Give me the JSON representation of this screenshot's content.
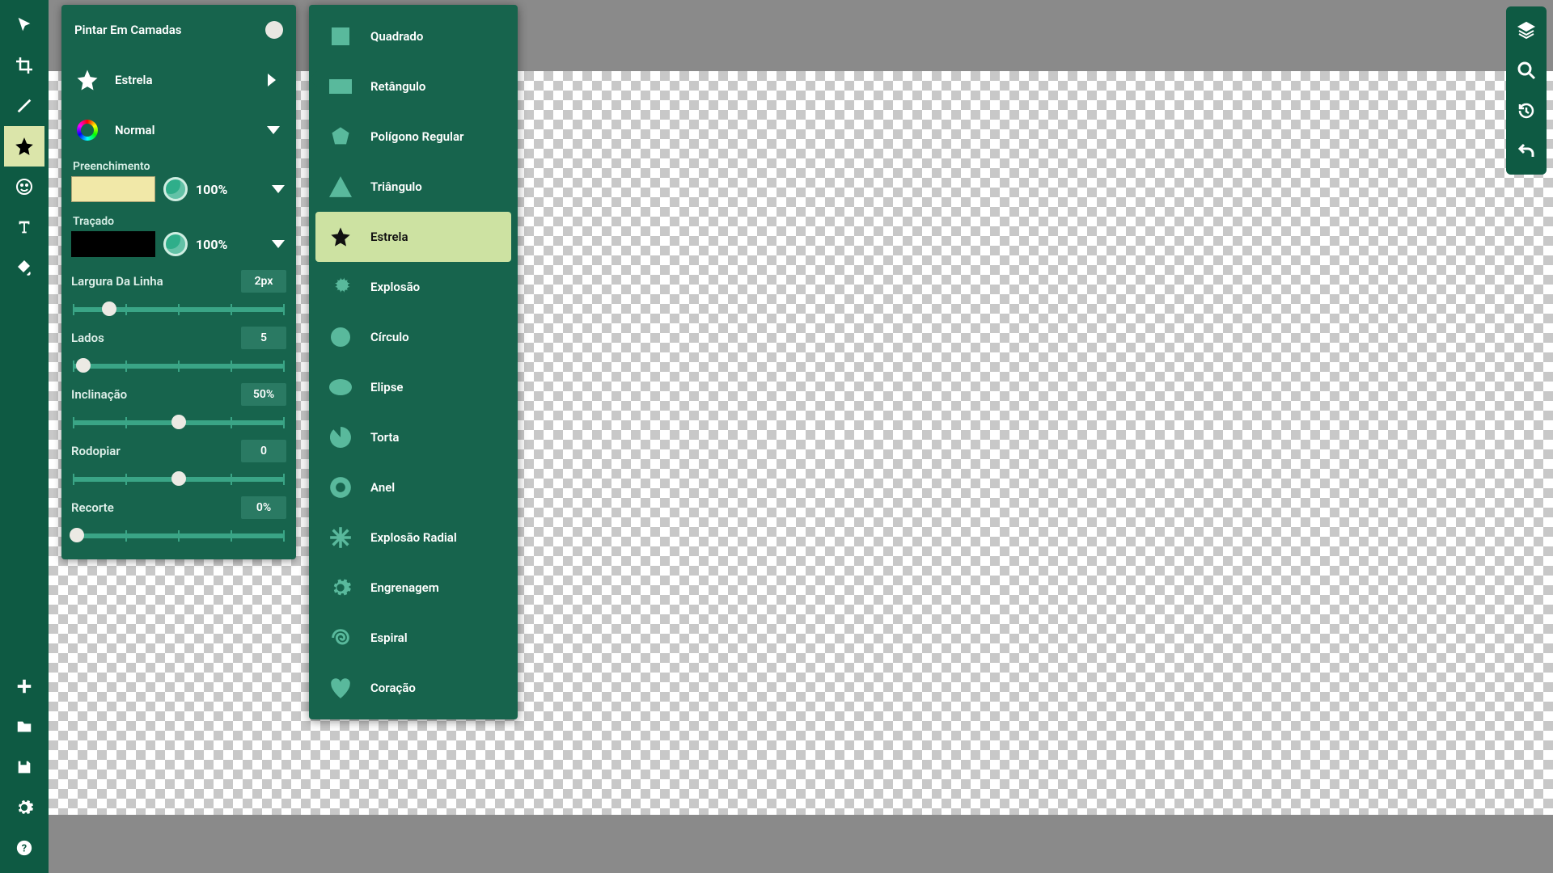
{
  "toolbar": {
    "tools": [
      "pointer",
      "crop",
      "line",
      "shape",
      "emoji",
      "text",
      "fill"
    ],
    "selected": "shape",
    "bottom": [
      "add",
      "folder",
      "save",
      "settings",
      "help"
    ]
  },
  "rightbar": [
    "layers",
    "zoom",
    "history",
    "undo"
  ],
  "opts": {
    "paint_in_layers": "Pintar Em Camadas",
    "shape_label": "Estrela",
    "blend_label": "Normal",
    "fill_title": "Preenchimento",
    "fill_color": "#f1e8a8",
    "fill_opacity": "100%",
    "stroke_title": "Traçado",
    "stroke_color": "#000000",
    "stroke_opacity": "100%",
    "params": [
      {
        "label": "Largura Da Linha",
        "value": "2px",
        "pos": 17
      },
      {
        "label": "Lados",
        "value": "5",
        "pos": 5
      },
      {
        "label": "Inclinação",
        "value": "50%",
        "pos": 50
      },
      {
        "label": "Rodopiar",
        "value": "0",
        "pos": 50
      },
      {
        "label": "Recorte",
        "value": "0%",
        "pos": 2
      }
    ]
  },
  "shapes": [
    {
      "id": "square",
      "label": "Quadrado"
    },
    {
      "id": "rect",
      "label": "Retângulo"
    },
    {
      "id": "polygon",
      "label": "Polígono Regular"
    },
    {
      "id": "triangle",
      "label": "Triângulo"
    },
    {
      "id": "star",
      "label": "Estrela",
      "selected": true
    },
    {
      "id": "burst",
      "label": "Explosão"
    },
    {
      "id": "circle",
      "label": "Círculo"
    },
    {
      "id": "ellipse",
      "label": "Elipse"
    },
    {
      "id": "pie",
      "label": "Torta"
    },
    {
      "id": "ring",
      "label": "Anel"
    },
    {
      "id": "radial",
      "label": "Explosão Radial"
    },
    {
      "id": "gear",
      "label": "Engrenagem"
    },
    {
      "id": "spiral",
      "label": "Espiral"
    },
    {
      "id": "heart",
      "label": "Coração"
    }
  ]
}
